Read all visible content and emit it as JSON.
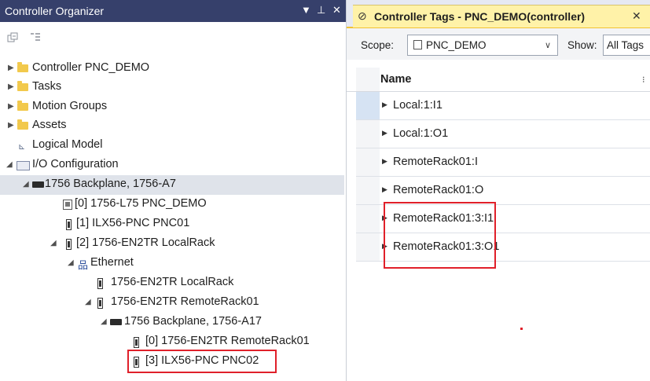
{
  "left_pane": {
    "title": "Controller Organizer",
    "controls": {
      "dropdown": "▼",
      "pin": "⊥",
      "close": "✕"
    },
    "tree": [
      {
        "label": "Controller PNC_DEMO",
        "icon": "folder-icon",
        "caret": "▶"
      },
      {
        "label": "Tasks",
        "icon": "folder-icon",
        "caret": "▶"
      },
      {
        "label": "Motion Groups",
        "icon": "folder-icon",
        "caret": "▶"
      },
      {
        "label": "Assets",
        "icon": "folder-icon",
        "caret": "▶"
      },
      {
        "label": "Logical Model",
        "icon": "logical-model-icon",
        "caret": ""
      },
      {
        "label": "I/O Configuration",
        "icon": "open-folder-icon",
        "caret": "◢"
      },
      {
        "label": "1756 Backplane, 1756-A7",
        "icon": "backplane-icon",
        "caret": "◢"
      },
      {
        "label": "[0] 1756-L75 PNC_DEMO",
        "icon": "controller-icon",
        "caret": ""
      },
      {
        "label": "[1] ILX56-PNC PNC01",
        "icon": "module-icon",
        "caret": ""
      },
      {
        "label": "[2] 1756-EN2TR LocalRack",
        "icon": "module-icon",
        "caret": "◢"
      },
      {
        "label": "Ethernet",
        "icon": "ethernet-icon",
        "caret": "◢"
      },
      {
        "label": "1756-EN2TR LocalRack",
        "icon": "module-icon",
        "caret": ""
      },
      {
        "label": "1756-EN2TR RemoteRack01",
        "icon": "module-icon",
        "caret": "◢"
      },
      {
        "label": "1756 Backplane, 1756-A17",
        "icon": "backplane-icon",
        "caret": "◢"
      },
      {
        "label": "[0] 1756-EN2TR RemoteRack01",
        "icon": "module-icon",
        "caret": ""
      },
      {
        "label": "[3] ILX56-PNC PNC02",
        "icon": "module-icon",
        "caret": ""
      }
    ]
  },
  "right_pane": {
    "tab": {
      "title": "Controller Tags - PNC_DEMO(controller)",
      "close": "✕"
    },
    "scope": {
      "label": "Scope:",
      "value": "PNC_DEMO",
      "dropdown": "∨"
    },
    "show": {
      "label": "Show:",
      "value": "All Tags"
    },
    "grid": {
      "header": "Name",
      "rows": [
        {
          "name": "Local:1:I1"
        },
        {
          "name": "Local:1:O1"
        },
        {
          "name": "RemoteRack01:I"
        },
        {
          "name": "RemoteRack01:O"
        },
        {
          "name": "RemoteRack01:3:I1"
        },
        {
          "name": "RemoteRack01:3:O1"
        }
      ]
    }
  },
  "colors": {
    "title_bar": "#36406b",
    "tab_active": "#fff2a8",
    "highlight": "#e0202a",
    "selected_row": "#dfe3ea"
  }
}
